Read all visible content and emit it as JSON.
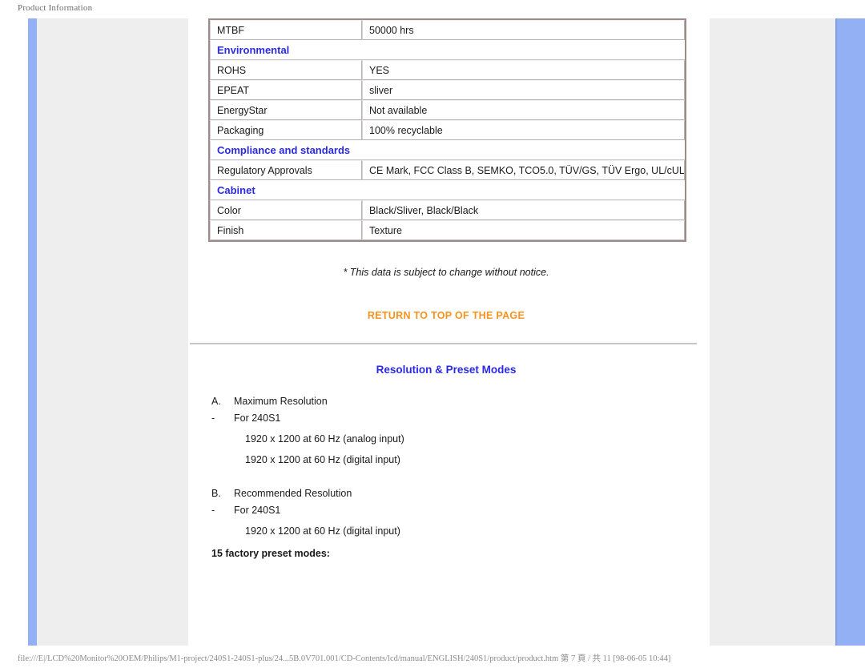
{
  "page": {
    "header_title": "Product Information",
    "footer": "file:///E|/LCD%20Monitor%20OEM/Philips/M1-project/240S1-240S1-plus/24...5B.0V701.001/CD-Contents/lcd/manual/ENGLISH/240S1/product/product.htm 第 7 頁 / 共 11 [98-06-05 10:44]"
  },
  "colors": {
    "section_blue": "#2a2ae6",
    "link_orange": "#f7931e",
    "rail_blue": "#93b0f4",
    "panel_gray": "#eeeeee"
  },
  "spec_table": {
    "rows": [
      {
        "type": "row",
        "label": "MTBF",
        "value": "50000 hrs"
      },
      {
        "type": "section",
        "label": "Environmental"
      },
      {
        "type": "row",
        "label": "ROHS",
        "value": "YES"
      },
      {
        "type": "row",
        "label": "EPEAT",
        "value": "sliver"
      },
      {
        "type": "row",
        "label": "EnergyStar",
        "value": "Not available"
      },
      {
        "type": "row",
        "label": "Packaging",
        "value": "100% recyclable"
      },
      {
        "type": "section",
        "label": "Compliance and standards"
      },
      {
        "type": "row",
        "label": "Regulatory Approvals",
        "value": "CE Mark, FCC Class B, SEMKO, TCO5.0, TÜV/GS, TÜV Ergo, UL/cUL"
      },
      {
        "type": "section",
        "label": "Cabinet"
      },
      {
        "type": "row",
        "label": "Color",
        "value": "Black/Sliver, Black/Black"
      },
      {
        "type": "row",
        "label": "Finish",
        "value": "Texture"
      }
    ]
  },
  "notice": "* This data is subject to change without notice.",
  "return_top_link": "RETURN TO TOP OF THE PAGE",
  "resolution": {
    "title": "Resolution & Preset Modes",
    "items": [
      {
        "marker": "A.",
        "text": "Maximum Resolution",
        "style": "head"
      },
      {
        "marker": "-",
        "text": "For 240S1",
        "style": "sub"
      },
      {
        "marker": "",
        "text": "1920 x 1200 at 60 Hz (analog input)",
        "style": "indent"
      },
      {
        "marker": "",
        "text": "1920 x 1200 at 60 Hz (digital input)",
        "style": "indent"
      },
      {
        "marker": "B.",
        "text": "Recommended Resolution",
        "style": "head"
      },
      {
        "marker": "-",
        "text": "For 240S1",
        "style": "sub"
      },
      {
        "marker": "",
        "text": "1920 x 1200 at 60 Hz (digital input)",
        "style": "indent"
      }
    ],
    "preset_heading": "15 factory preset modes:"
  }
}
